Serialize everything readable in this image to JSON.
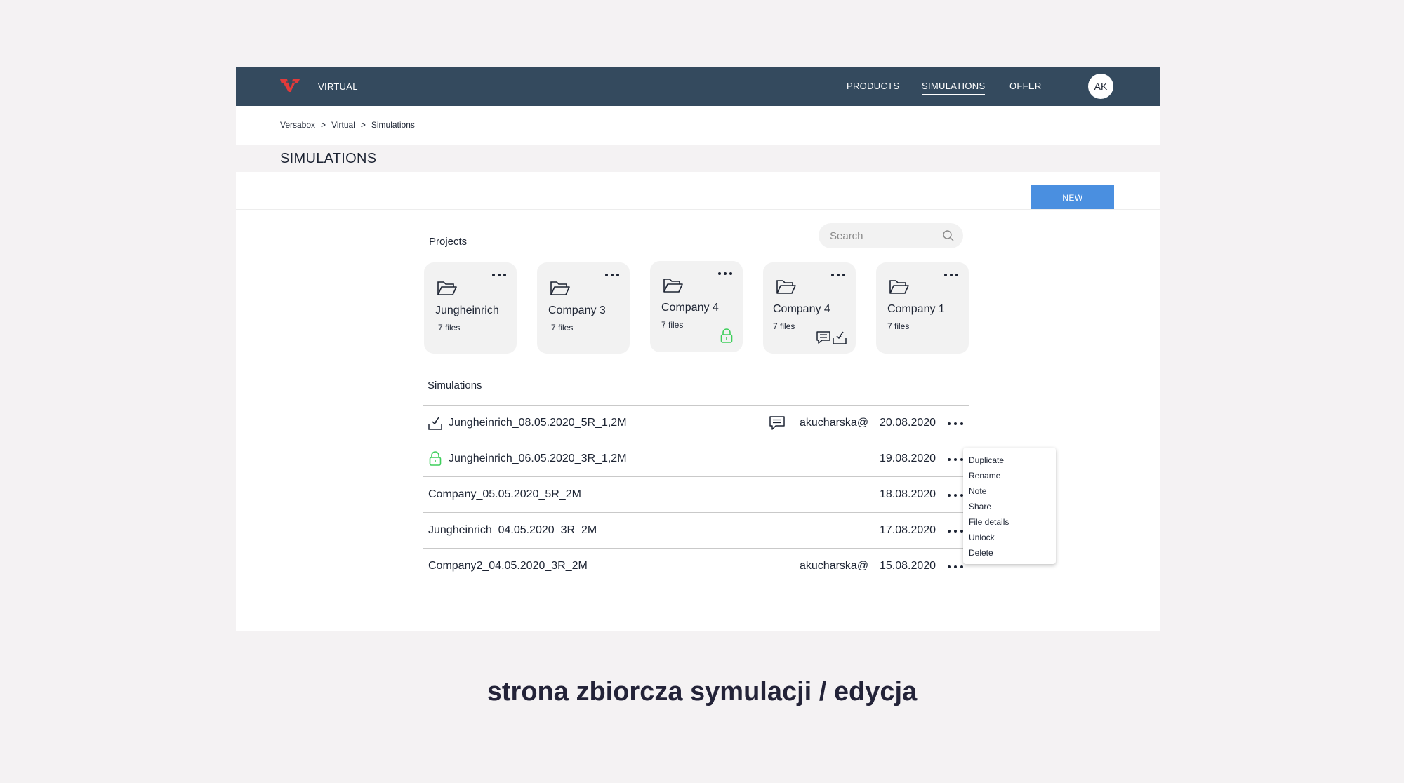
{
  "header": {
    "brand": "VIRTUAL",
    "nav": [
      {
        "label": "PRODUCTS"
      },
      {
        "label": "SIMULATIONS",
        "active": true
      },
      {
        "label": "OFFER"
      }
    ],
    "avatar_initials": "AK",
    "logo_color": "#e23a3a",
    "bar_color": "#344a5e"
  },
  "breadcrumb": [
    "Versabox",
    "Virtual",
    "Simulations"
  ],
  "breadcrumb_sep": ">",
  "page_title": "SIMULATIONS",
  "new_button": "NEW",
  "projects": {
    "heading": "Projects",
    "search_placeholder": "Search",
    "cards": [
      {
        "name": "Jungheinrich",
        "files": "7 files",
        "badges": []
      },
      {
        "name": "Company 3",
        "files": "7 files",
        "badges": []
      },
      {
        "name": "Company 4",
        "files": "7 files",
        "badges": [
          "lock-icon"
        ]
      },
      {
        "name": "Company 4",
        "files": "7 files",
        "badges": [
          "note-icon",
          "download-icon"
        ]
      },
      {
        "name": "Company 1",
        "files": "7 files",
        "badges": []
      }
    ]
  },
  "simulations": {
    "heading": "Simulations",
    "rows": [
      {
        "name": "Jungheinrich_08.05.2020_5R_1,2M",
        "icon": "download-icon",
        "note": true,
        "user": "akucharska@",
        "date": "20.08.2020"
      },
      {
        "name": "Jungheinrich_06.05.2020_3R_1,2M",
        "icon": "lock-icon",
        "note": false,
        "user": "",
        "date": "19.08.2020"
      },
      {
        "name": "Company_05.05.2020_5R_2M",
        "icon": "",
        "note": false,
        "user": "",
        "date": "18.08.2020"
      },
      {
        "name": "Jungheinrich_04.05.2020_3R_2M",
        "icon": "",
        "note": false,
        "user": "",
        "date": "17.08.2020"
      },
      {
        "name": "Company2_04.05.2020_3R_2M",
        "icon": "",
        "note": false,
        "user": "akucharska@",
        "date": "15.08.2020"
      }
    ]
  },
  "context_menu": [
    "Duplicate",
    "Rename",
    "Note",
    "Share",
    "File details",
    "Unlock",
    "Delete"
  ],
  "colors": {
    "accent": "#4a8fe0",
    "lock": "#3fcf5c"
  },
  "caption": "strona zbiorcza symulacji / edycja"
}
